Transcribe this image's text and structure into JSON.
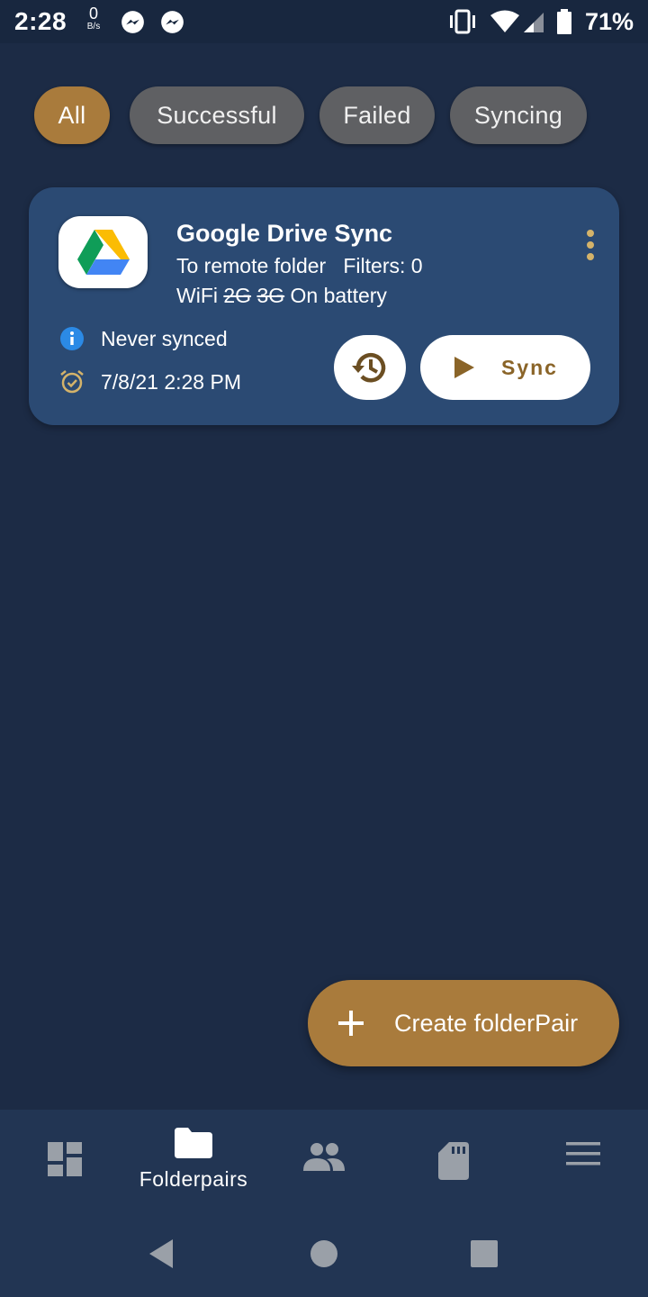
{
  "status_bar": {
    "time": "2:28",
    "net_speed_value": "0",
    "net_speed_unit": "B/s",
    "notification_icons": [
      "messenger-icon",
      "messenger-icon"
    ],
    "battery_percent": "71%"
  },
  "filters": {
    "chips": [
      {
        "label": "All",
        "selected": true
      },
      {
        "label": "Successful",
        "selected": false
      },
      {
        "label": "Failed",
        "selected": false
      },
      {
        "label": "Syncing",
        "selected": false
      }
    ]
  },
  "folderpair": {
    "name": "Google Drive Sync",
    "direction": "To remote folder",
    "filters": "Filters: 0",
    "network_wifi": "WiFi",
    "network_2g": "2G",
    "network_3g": "3G",
    "power": "On battery",
    "last_sync": "Never synced",
    "schedule": "7/8/21 2:28 PM",
    "sync_label": "Sync"
  },
  "fab": {
    "label": "Create folderPair"
  },
  "bottom_nav": {
    "items": [
      {
        "icon": "dashboard-icon",
        "label": ""
      },
      {
        "icon": "folder-icon",
        "label": "Folderpairs",
        "selected": true
      },
      {
        "icon": "accounts-icon",
        "label": ""
      },
      {
        "icon": "sd-card-icon",
        "label": ""
      },
      {
        "icon": "menu-icon",
        "label": ""
      }
    ]
  },
  "colors": {
    "background": "#1c2b45",
    "card": "#2b4a73",
    "accent": "#a97b3c",
    "chip": "#5f6063",
    "nav": "#223553"
  }
}
